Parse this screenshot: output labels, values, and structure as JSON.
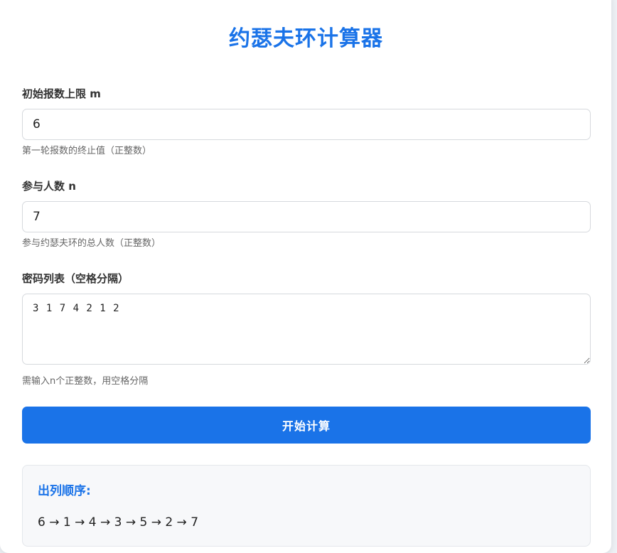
{
  "app": {
    "title": "约瑟夫环计算器"
  },
  "form": {
    "m": {
      "label": "初始报数上限 m",
      "value": "6",
      "hint": "第一轮报数的终止值（正整数）"
    },
    "n": {
      "label": "参与人数 n",
      "value": "7",
      "hint": "参与约瑟夫环的总人数（正整数）"
    },
    "passwords": {
      "label": "密码列表（空格分隔）",
      "value": "3 1 7 4 2 1 2",
      "hint": "需输入n个正整数，用空格分隔"
    },
    "submit_label": "开始计算"
  },
  "result": {
    "title": "出列顺序:",
    "sequence": "6 → 1 → 4 → 3 → 5 → 2 → 7"
  },
  "colors": {
    "accent": "#1a73e8",
    "result_background": "#f7f8fa"
  }
}
